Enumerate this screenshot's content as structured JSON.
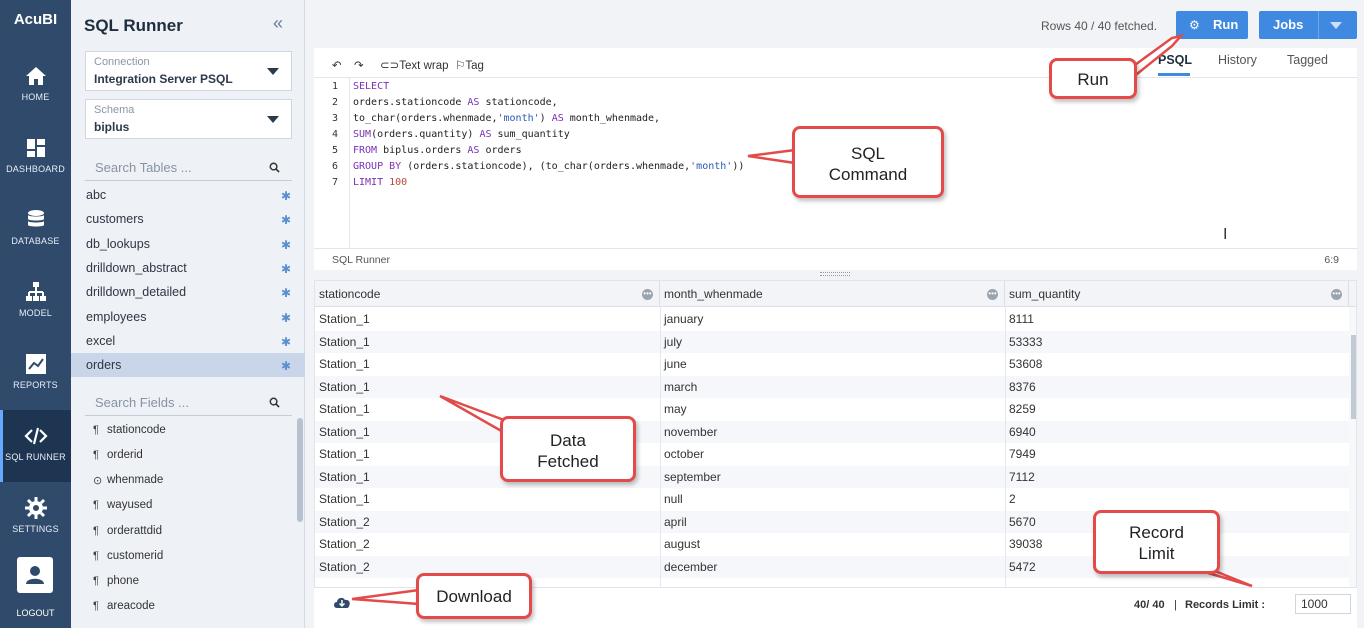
{
  "app": {
    "brand": "AcuBI"
  },
  "nav": {
    "items": [
      {
        "label": "HOME",
        "icon": "home-icon"
      },
      {
        "label": "DASHBOARD",
        "icon": "dashboard-icon"
      },
      {
        "label": "DATABASE",
        "icon": "database-icon"
      },
      {
        "label": "MODEL",
        "icon": "model-icon"
      },
      {
        "label": "REPORTS",
        "icon": "reports-icon"
      },
      {
        "label": "SQL RUNNER",
        "icon": "code-icon",
        "active": true
      },
      {
        "label": "SETTINGS",
        "icon": "gear-icon"
      }
    ],
    "logout": "LOGOUT"
  },
  "sidebar": {
    "title": "SQL Runner",
    "connection": {
      "caption": "Connection",
      "value": "Integration Server PSQL"
    },
    "schema": {
      "caption": "Schema",
      "value": "biplus"
    },
    "search_tables_placeholder": "Search Tables ...",
    "tables": [
      "abc",
      "customers",
      "db_lookups",
      "drilldown_abstract",
      "drilldown_detailed",
      "employees",
      "excel",
      "orders"
    ],
    "selected_table": "orders",
    "search_fields_placeholder": "Search Fields ...",
    "fields": [
      {
        "name": "stationcode",
        "icon": "¶"
      },
      {
        "name": "orderid",
        "icon": "¶"
      },
      {
        "name": "whenmade",
        "icon": "⊙"
      },
      {
        "name": "wayused",
        "icon": "¶"
      },
      {
        "name": "orderattdid",
        "icon": "¶"
      },
      {
        "name": "customerid",
        "icon": "¶"
      },
      {
        "name": "phone",
        "icon": "¶"
      },
      {
        "name": "areacode",
        "icon": "¶"
      }
    ]
  },
  "header": {
    "rows_info": "Rows 40 / 40 fetched.",
    "run_label": "Run",
    "jobs_label": "Jobs"
  },
  "editor": {
    "toolbar": {
      "text_wrap": "Text wrap",
      "tag": "Tag"
    },
    "tabs": [
      "PSQL",
      "History",
      "Tagged"
    ],
    "active_tab": "PSQL",
    "line_numbers": [
      "1",
      "2",
      "3",
      "4",
      "5",
      "6",
      "7"
    ],
    "status_left": "SQL Runner",
    "status_right": "6:9"
  },
  "results": {
    "columns": [
      "stationcode",
      "month_whenmade",
      "sum_quantity"
    ],
    "rows": [
      [
        "Station_1",
        "january",
        "8111"
      ],
      [
        "Station_1",
        "july",
        "53333"
      ],
      [
        "Station_1",
        "june",
        "53608"
      ],
      [
        "Station_1",
        "march",
        "8376"
      ],
      [
        "Station_1",
        "may",
        "8259"
      ],
      [
        "Station_1",
        "november",
        "6940"
      ],
      [
        "Station_1",
        "october",
        "7949"
      ],
      [
        "Station_1",
        "september",
        "7112"
      ],
      [
        "Station_1",
        "null",
        "2"
      ],
      [
        "Station_2",
        "april",
        "5670"
      ],
      [
        "Station_2",
        "august",
        "39038"
      ],
      [
        "Station_2",
        "december",
        "5472"
      ]
    ]
  },
  "footer": {
    "count": "40/ 40",
    "separator": "|",
    "records_limit_label": "Records Limit :",
    "records_limit_value": "1000"
  },
  "callouts": {
    "run": "Run",
    "sql_command": "SQL\nCommand",
    "data_fetched": "Data\nFetched",
    "record_limit": "Record\nLimit",
    "download": "Download"
  },
  "colors": {
    "nav_bg": "#2f4a6b",
    "accent": "#3f8ae0",
    "callout_border": "#e34b4b"
  }
}
